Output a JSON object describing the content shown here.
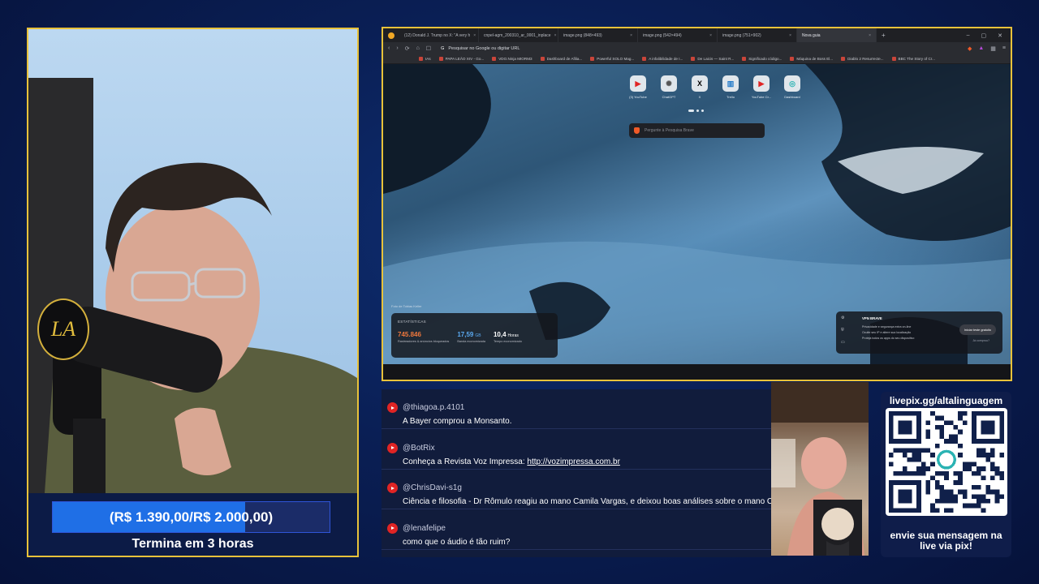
{
  "goal": {
    "text": "(R$ 1.390,00/R$ 2.000,00)",
    "raised": 1390.0,
    "target": 2000.0,
    "ends_label": "Termina em 3 horas"
  },
  "webcam": {
    "logo_text": "LA"
  },
  "browser": {
    "tabs": [
      {
        "label": "(12) Donald J. Trump no X: \"A very h",
        "active": false
      },
      {
        "label": "cnpel-agm_200310_ar_0001_inplace",
        "active": false
      },
      {
        "label": "image.png (848×493)",
        "active": false
      },
      {
        "label": "image.png (542×494)",
        "active": false
      },
      {
        "label": "image.png (751×902)",
        "active": false
      },
      {
        "label": "Nova guia",
        "active": true
      }
    ],
    "address_placeholder": "Pesquisar no Google ou digitar URL",
    "bookmarks": [
      "IAs",
      "PAPA LEÃO XIV - Go...",
      "VDO.Ninja MIORM3",
      "Dashboard de Afilia...",
      "Powerful SOLO Mag...",
      "A infalibilidade de I...",
      "De Laicis — Saint R...",
      "Significado código...",
      "Máquina de Boss El...",
      "Diablo 2 Resurrecte...",
      "BBC The Story of Cr..."
    ],
    "shortcuts": [
      {
        "label": "(3) YouTube",
        "icon": "youtube-icon",
        "color": "#e02424"
      },
      {
        "label": "ChatGPT",
        "icon": "chatgpt-icon",
        "color": "#555555"
      },
      {
        "label": "X",
        "icon": "x-icon",
        "color": "#000000"
      },
      {
        "label": "Trello",
        "icon": "trello-icon",
        "color": "#1e78c8"
      },
      {
        "label": "YouTube Cr...",
        "icon": "youtube-icon",
        "color": "#e02424"
      },
      {
        "label": "Dashboard",
        "icon": "dashboard-icon",
        "color": "#2bb3b3"
      }
    ],
    "search_placeholder": "Pergunte à Pesquisa Brave",
    "photo_credit": "Foto de Tobias Keller",
    "stats": {
      "title": "ESTATÍSTICAS",
      "items": [
        {
          "value": "745.846",
          "unit": "",
          "label": "Rastreadores & anúncios bloqueados",
          "color": "#f0783c"
        },
        {
          "value": "17,59",
          "unit": "GB",
          "label": "Banda economizada",
          "color": "#5aa9f0"
        },
        {
          "value": "10,4",
          "unit": "Horas",
          "label": "Tempo economizado",
          "color": "#ffffff"
        }
      ]
    },
    "vpn": {
      "title": "VPN BRAVE",
      "lines": [
        "Privacidade e segurança extra on-line",
        "Oculte seu IP e altere sua localização",
        "Proteja todos os apps do seu dispositivo"
      ],
      "button": "Iniciar teste gratuito",
      "link": "Já comprou?"
    }
  },
  "chat": {
    "messages": [
      {
        "user": "@thiagoa.p.4101",
        "text": "A Bayer comprou a Monsanto."
      },
      {
        "user": "@BotRix",
        "text": "Conheça a Revista Voz Impressa: ",
        "link": "http://vozimpressa.com.br"
      },
      {
        "user": "@ChrisDavi-s1g",
        "text": "Ciência e filosofia - Dr Rômulo reagiu ao mano Camila Vargas, e deixou boas análises sobre o mano Cam"
      },
      {
        "user": "@lenafelipe",
        "text": "como que o áudio é tão ruim?"
      }
    ]
  },
  "donation": {
    "url": "livepix.gg/altalinguagem",
    "cta_line1": "envie sua mensagem na",
    "cta_line2": "live via pix!"
  }
}
